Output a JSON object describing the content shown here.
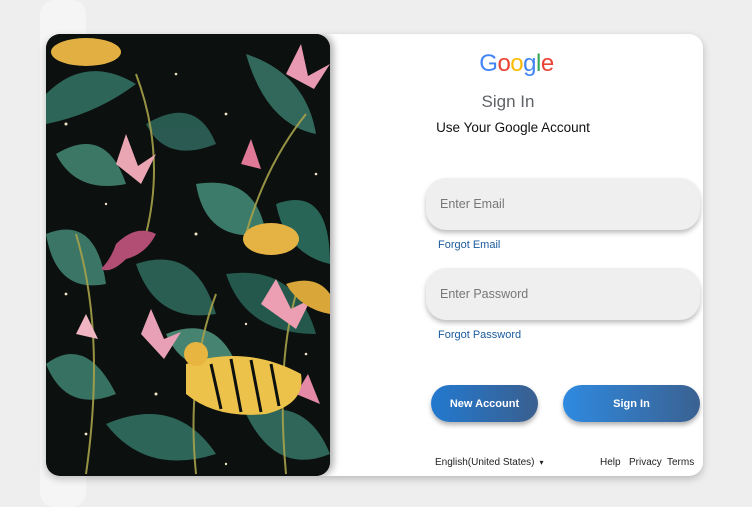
{
  "logo": {
    "letters": [
      {
        "char": "G",
        "color": "#4285F4"
      },
      {
        "char": "o",
        "color": "#EA4335"
      },
      {
        "char": "o",
        "color": "#FBBC05"
      },
      {
        "char": "g",
        "color": "#4285F4"
      },
      {
        "char": "l",
        "color": "#34A853"
      },
      {
        "char": "e",
        "color": "#EA4335"
      }
    ]
  },
  "header": {
    "title": "Sign In",
    "subtitle": "Use Your Google Account"
  },
  "form": {
    "email_placeholder": "Enter Email",
    "forgot_email": "Forgot Email",
    "password_placeholder": "Enter Password",
    "forgot_password": "Forgot Password"
  },
  "actions": {
    "new_account": "New Account",
    "sign_in": "Sign In"
  },
  "footer": {
    "language": "English(United States)",
    "language_caret": "▾",
    "help": "Help",
    "privacy": "Privacy",
    "terms": "Terms"
  },
  "colors": {
    "link": "#1a5a9c",
    "button_start": "#2379cf",
    "button_end": "#3a5f8f"
  }
}
